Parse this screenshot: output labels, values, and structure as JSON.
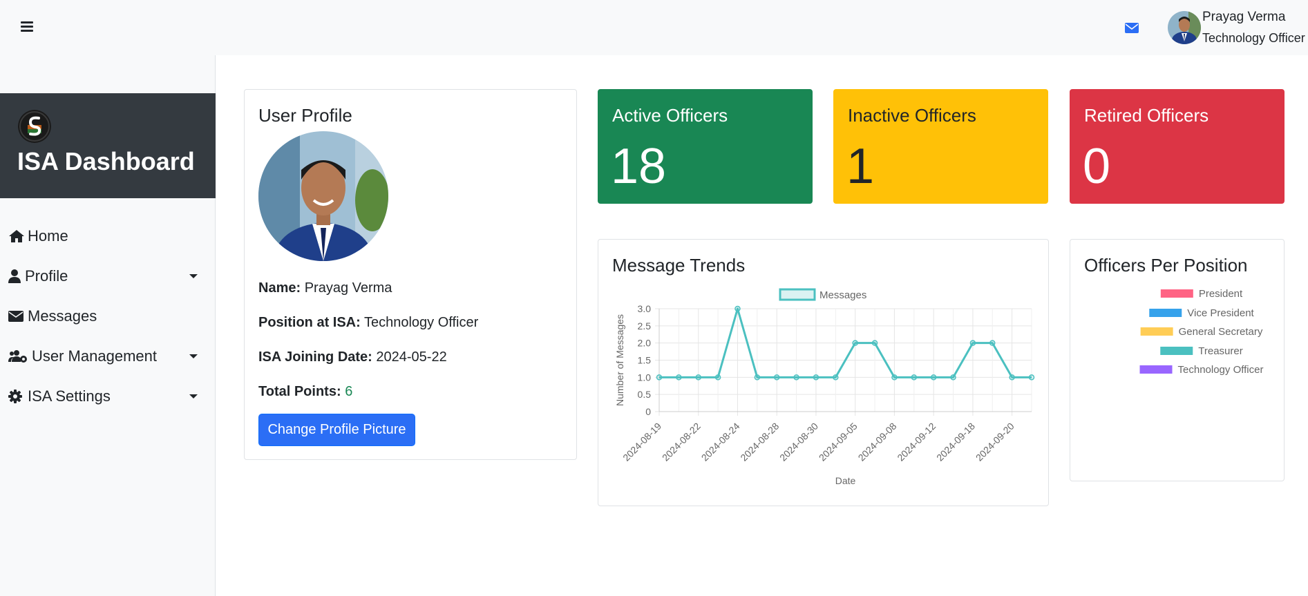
{
  "topbar": {
    "user_name": "Prayag Verma",
    "user_role": "Technology Officer"
  },
  "sidebar": {
    "brand_title": "ISA Dashboard",
    "items": [
      {
        "label": "Home",
        "icon": "home-icon"
      },
      {
        "label": "Profile",
        "icon": "user-icon",
        "has_dropdown": true
      },
      {
        "label": "Messages",
        "icon": "envelope-icon"
      },
      {
        "label": "User Management",
        "icon": "users-cog-icon",
        "has_dropdown": true
      },
      {
        "label": "ISA Settings",
        "icon": "gear-icon",
        "has_dropdown": true
      }
    ]
  },
  "profile": {
    "title": "User Profile",
    "name_label": "Name:",
    "name_value": "Prayag Verma",
    "position_label": "Position at ISA:",
    "position_value": "Technology Officer",
    "joining_label": "ISA Joining Date:",
    "joining_value": "2024-05-22",
    "points_label": "Total Points:",
    "points_value": "6",
    "change_pic_button": "Change Profile Picture"
  },
  "stats": [
    {
      "title": "Active Officers",
      "value": "18",
      "color": "#198754",
      "text_color": "#ffffff"
    },
    {
      "title": "Inactive Officers",
      "value": "1",
      "color": "#ffc107",
      "text_color": "#212529"
    },
    {
      "title": "Retired Officers",
      "value": "0",
      "color": "#dc3545",
      "text_color": "#ffffff"
    }
  ],
  "message_trends": {
    "title": "Message Trends"
  },
  "positions": {
    "title": "Officers Per Position"
  },
  "chart_data": [
    {
      "type": "line",
      "xlabel": "Date",
      "ylabel": "Number of Messages",
      "ylim": [
        0,
        3
      ],
      "yticks": [
        "0",
        "0.5",
        "1.0",
        "1.5",
        "2.0",
        "2.5",
        "3.0"
      ],
      "x_tick_labels": [
        "2024-08-19",
        "2024-08-22",
        "2024-08-24",
        "2024-08-28",
        "2024-08-30",
        "2024-09-05",
        "2024-09-08",
        "2024-09-12",
        "2024-09-18",
        "2024-09-20"
      ],
      "series": [
        {
          "name": "Messages",
          "color": "#4bc0c0",
          "values": [
            1,
            1,
            1,
            1,
            3,
            1,
            1,
            1,
            1,
            1,
            2,
            2,
            1,
            1,
            1,
            1,
            2,
            2,
            1,
            1
          ]
        }
      ],
      "legend": "top",
      "grid": true
    },
    {
      "type": "bar",
      "categories": [
        "President",
        "Vice President",
        "General Secretary",
        "Treasurer",
        "Technology Officer"
      ],
      "colors": [
        "#ff6384",
        "#36a2eb",
        "#ffcd56",
        "#4bc0c0",
        "#9966ff"
      ],
      "legend": "top"
    }
  ]
}
